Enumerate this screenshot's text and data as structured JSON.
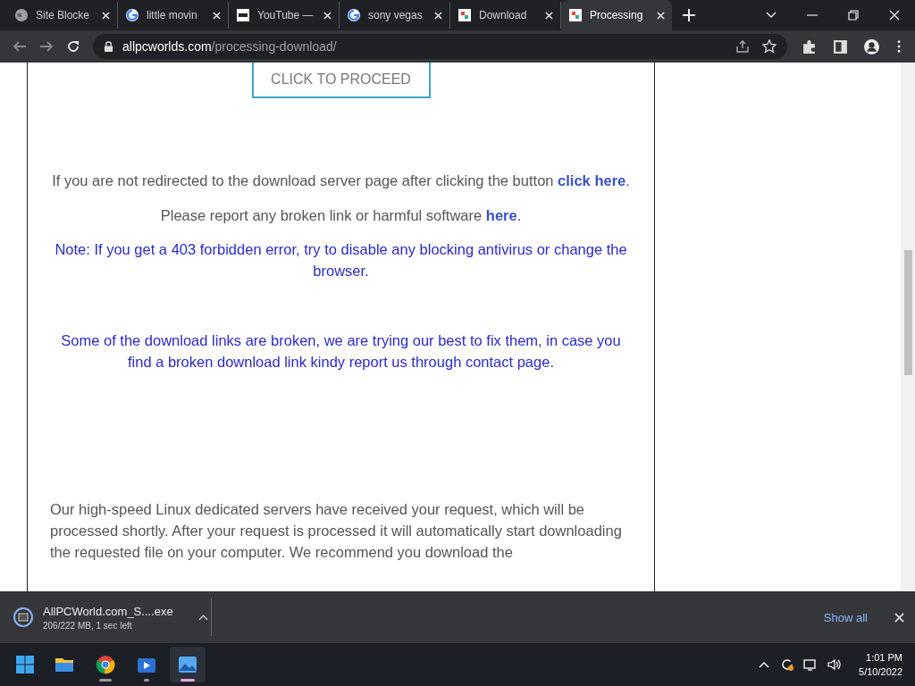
{
  "tabs": [
    {
      "title": "Site Blocke",
      "kind": "globe",
      "selected": false
    },
    {
      "title": "little movin",
      "kind": "google",
      "selected": false
    },
    {
      "title": "YouTube —",
      "kind": "dark",
      "selected": false
    },
    {
      "title": "sony vegas",
      "kind": "google",
      "selected": false
    },
    {
      "title": "Download",
      "kind": "site",
      "selected": false
    },
    {
      "title": "Processing",
      "kind": "site",
      "selected": true
    }
  ],
  "address": {
    "domain": "allpcworlds.com",
    "path": "/processing-download/"
  },
  "page": {
    "button": "CLICK TO PROCEED",
    "redirect_text": "If you are not redirected to the download server page after clicking the button",
    "redirect_link": "click here",
    "redirect_end": ".",
    "report_text": "Please report any broken link or harmful software",
    "report_link": "here",
    "report_end": ".",
    "note": "Note: If you get a 403 forbidden error, try to disable any blocking antivirus or change the browser.",
    "broken": "Some of the download links are broken, we are trying our best to fix them, in case you find a broken download link kindy report us through contact page.",
    "paragraph": "Our high-speed Linux dedicated servers have received your request, which will be processed shortly. After your request is processed it will automatically start downloading the requested file on your computer. We recommend you download the"
  },
  "download": {
    "file": "AllPCWorld.com_S....exe",
    "status": "206/222 MB, 1 sec left",
    "show_all": "Show all"
  },
  "taskbar": {
    "time": "1:01 PM",
    "date": "5/10/2022",
    "apps": [
      {
        "kind": "files",
        "active": false,
        "selected": false
      },
      {
        "kind": "chrome",
        "active": true,
        "selected": false
      },
      {
        "kind": "video",
        "active": true,
        "selected": false
      },
      {
        "kind": "photos",
        "active": true,
        "selected": true
      }
    ]
  }
}
